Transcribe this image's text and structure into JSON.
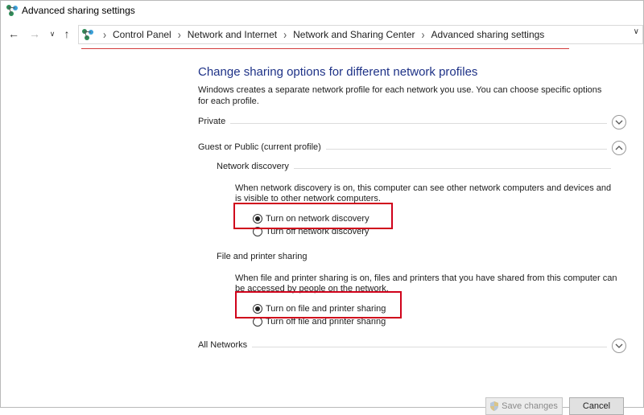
{
  "window": {
    "title": "Advanced sharing settings"
  },
  "breadcrumbs": [
    "Control Panel",
    "Network and Internet",
    "Network and Sharing Center",
    "Advanced sharing settings"
  ],
  "page": {
    "heading": "Change sharing options for different network profiles",
    "description": "Windows creates a separate network profile for each network you use. You can choose specific options for each profile."
  },
  "profiles": {
    "private": {
      "label": "Private",
      "expanded": false
    },
    "guest": {
      "label": "Guest or Public (current profile)",
      "expanded": true
    },
    "all": {
      "label": "All Networks",
      "expanded": false
    }
  },
  "network_discovery": {
    "label": "Network discovery",
    "description": "When network discovery is on, this computer can see other network computers and devices and is visible to other network computers.",
    "options": [
      {
        "label": "Turn on network discovery",
        "checked": true
      },
      {
        "label": "Turn off network discovery",
        "checked": false
      }
    ]
  },
  "file_printer_sharing": {
    "label": "File and printer sharing",
    "description": "When file and printer sharing is on, files and printers that you have shared from this computer can be accessed by people on the network.",
    "options": [
      {
        "label": "Turn on file and printer sharing",
        "checked": true
      },
      {
        "label": "Turn off file and printer sharing",
        "checked": false
      }
    ]
  },
  "buttons": {
    "save": "Save changes",
    "cancel": "Cancel"
  },
  "colors": {
    "heading": "#1e3287",
    "highlight": "#d0021b",
    "address_underline": "#d23c3c"
  }
}
